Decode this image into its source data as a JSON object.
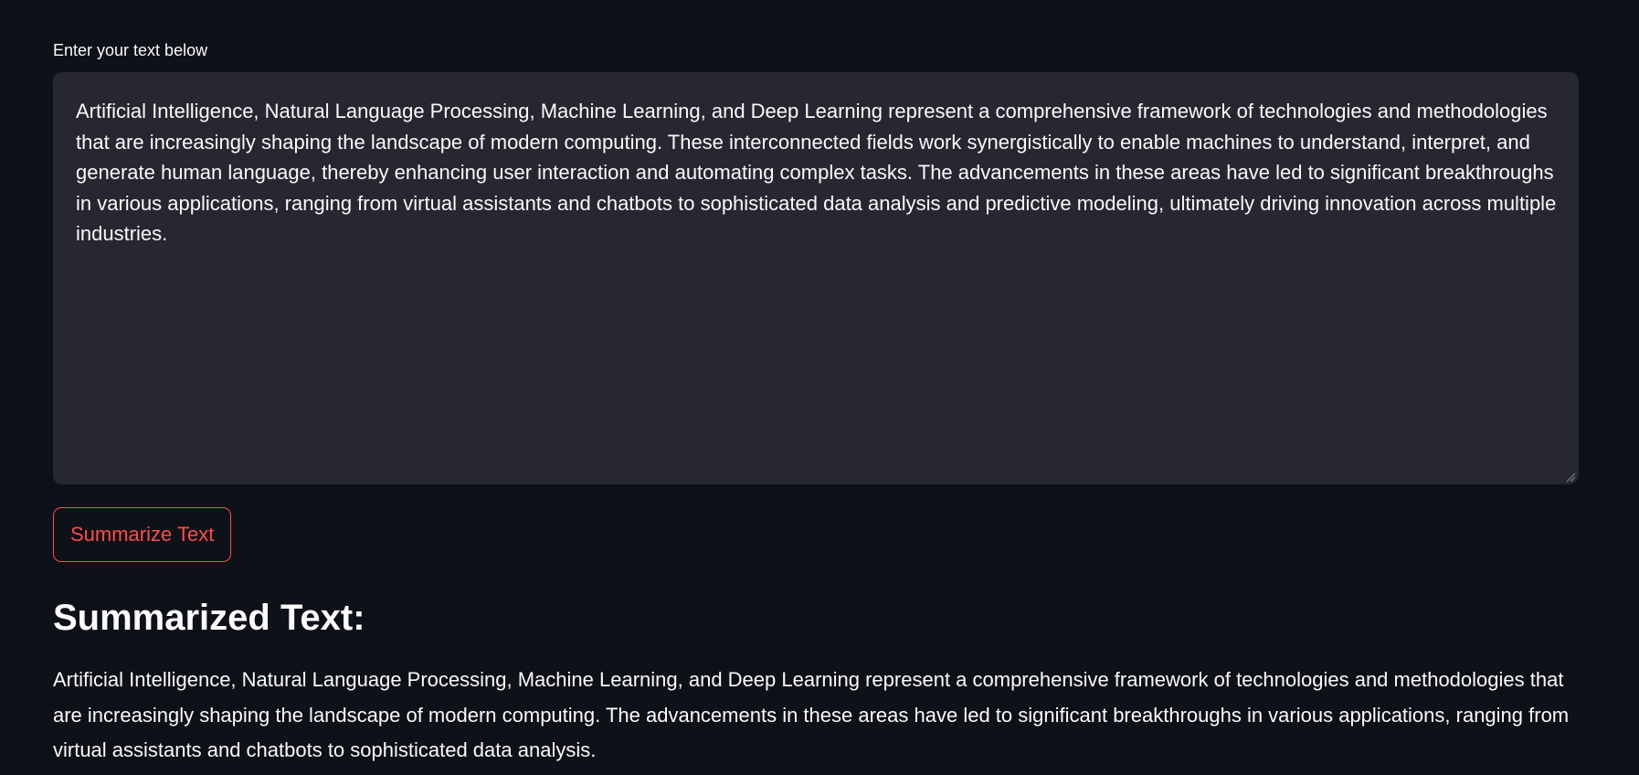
{
  "input": {
    "label": "Enter your text below",
    "value": "Artificial Intelligence, Natural Language Processing, Machine Learning, and Deep Learning represent a comprehensive framework of technologies and methodologies that are increasingly shaping the landscape of modern computing. These interconnected fields work synergistically to enable machines to understand, interpret, and generate human language, thereby enhancing user interaction and automating complex tasks. The advancements in these areas have led to significant breakthroughs in various applications, ranging from virtual assistants and chatbots to sophisticated data analysis and predictive modeling, ultimately driving innovation across multiple industries."
  },
  "actions": {
    "summarize_label": "Summarize Text"
  },
  "result": {
    "heading": "Summarized Text:",
    "text": "Artificial Intelligence, Natural Language Processing, Machine Learning, and Deep Learning represent a comprehensive framework of technologies and methodologies that are increasingly shaping the landscape of modern computing. The advancements in these areas have led to significant breakthroughs in various applications, ranging from virtual assistants and chatbots to sophisticated data analysis."
  },
  "theme": {
    "background": "#0e1117",
    "input_background": "#262730",
    "text": "#fafafa",
    "accent": "#ff4b4b"
  },
  "icons": {
    "resize_handle": "resize-handle-icon"
  }
}
